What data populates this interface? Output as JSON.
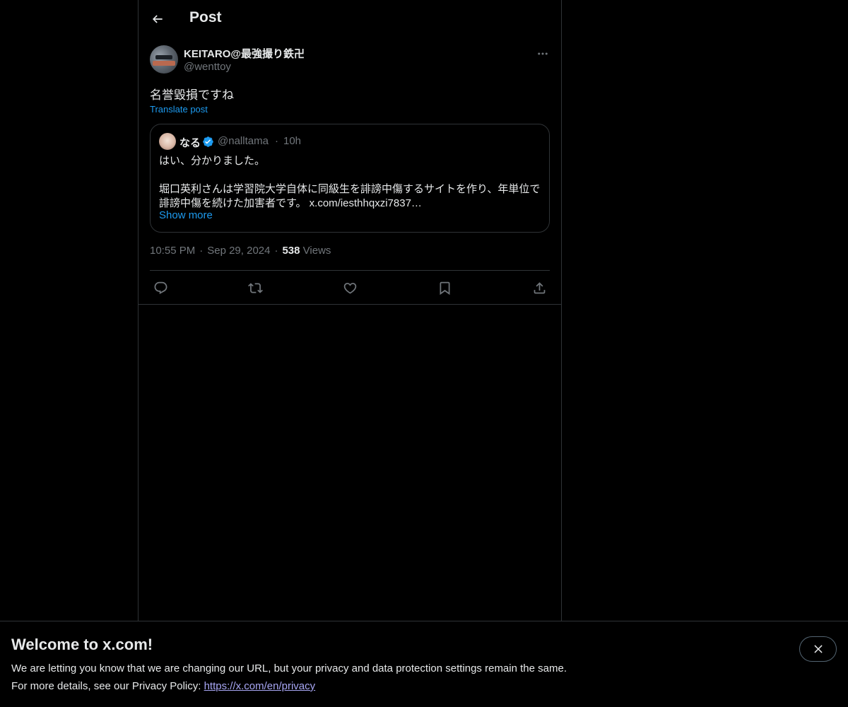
{
  "header": {
    "title": "Post",
    "back_icon": "arrow-left-icon"
  },
  "post": {
    "author_name": "KEITARO@最強撮り鉄卍",
    "author_handle": "@wenttoy",
    "text": "名誉毀損ですね",
    "translate_label": "Translate post",
    "time": "10:55 PM",
    "date": "Sep 29, 2024",
    "views_count": "538",
    "views_label": "Views",
    "separator": "·"
  },
  "quote": {
    "name": "なる",
    "verified_icon": "verified-badge-icon",
    "handle": "@nalltama",
    "separator": "·",
    "time": "10h",
    "line1": "はい、分かりました。",
    "line2": "堀口英利さんは学習院大学自体に同級生を誹謗中傷するサイトを作り、年単位で",
    "line3": "誹謗中傷を続けた加害者です。 x.com/iesthhqxzi7837…",
    "show_more": "Show more"
  },
  "actions": {
    "reply_icon": "reply-icon",
    "repost_icon": "repost-icon",
    "like_icon": "heart-icon",
    "bookmark_icon": "bookmark-icon",
    "share_icon": "share-icon"
  },
  "banner": {
    "title": "Welcome to x.com!",
    "text1": "We are letting you know that we are changing our URL, but your privacy and data protection settings remain the same.",
    "text2_prefix": "For more details, see our Privacy Policy: ",
    "link": "https://x.com/en/privacy"
  },
  "colors": {
    "background": "#000000",
    "text": "#e7e9ea",
    "secondary": "#71767b",
    "accent": "#1d9bf0",
    "border": "#2f3336",
    "link_visited": "#a8a7f5"
  }
}
